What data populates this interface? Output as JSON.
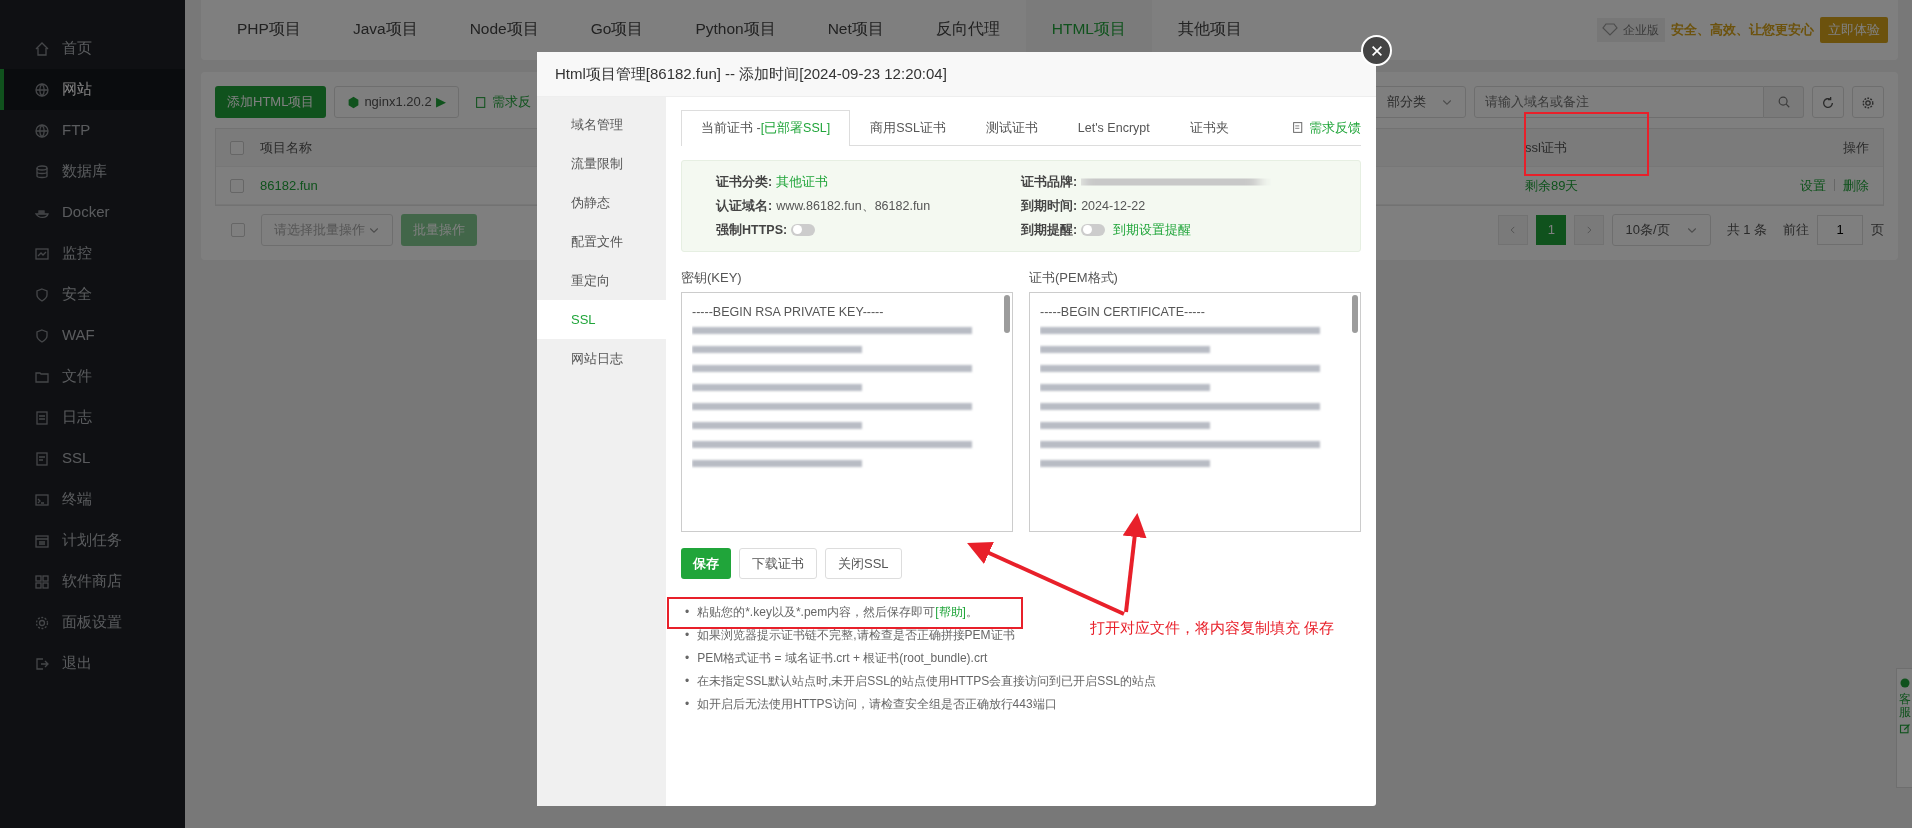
{
  "sidebar": {
    "items": [
      {
        "label": "首页",
        "selected": false
      },
      {
        "label": "网站",
        "selected": true
      },
      {
        "label": "FTP",
        "selected": false
      },
      {
        "label": "数据库",
        "selected": false
      },
      {
        "label": "Docker",
        "selected": false
      },
      {
        "label": "监控",
        "selected": false
      },
      {
        "label": "安全",
        "selected": false
      },
      {
        "label": "WAF",
        "selected": false
      },
      {
        "label": "文件",
        "selected": false
      },
      {
        "label": "日志",
        "selected": false
      },
      {
        "label": "SSL",
        "selected": false
      },
      {
        "label": "终端",
        "selected": false
      },
      {
        "label": "计划任务",
        "selected": false
      },
      {
        "label": "软件商店",
        "selected": false
      },
      {
        "label": "面板设置",
        "selected": false
      },
      {
        "label": "退出",
        "selected": false
      }
    ]
  },
  "top_tabs": [
    {
      "label": "PHP项目",
      "selected": false
    },
    {
      "label": "Java项目",
      "selected": false
    },
    {
      "label": "Node项目",
      "selected": false
    },
    {
      "label": "Go项目",
      "selected": false
    },
    {
      "label": "Python项目",
      "selected": false
    },
    {
      "label": "Net项目",
      "selected": false
    },
    {
      "label": "反向代理",
      "selected": false
    },
    {
      "label": "HTML项目",
      "selected": true
    },
    {
      "label": "其他项目",
      "selected": false
    }
  ],
  "promo": {
    "badge": "企业版",
    "slogan": "安全、高效、让您更安心",
    "button": "立即体验"
  },
  "toolbar": {
    "add_button": "添加HTML项目",
    "nginx_button": "nginx1.20.2",
    "nginx_play": "▶",
    "feedback": "需求反",
    "category_select": "部分类",
    "search_placeholder": "请输入域名或备注"
  },
  "table": {
    "columns": [
      "项目名称",
      "ssl证书",
      "操作"
    ],
    "select_all_checked": false,
    "rows": [
      {
        "checked": false,
        "name": "86182.fun",
        "ssl": "剩余89天",
        "actions": [
          "设置",
          "删除"
        ]
      }
    ]
  },
  "batch": {
    "checked": false,
    "select_placeholder": "请选择批量操作",
    "button": "批量操作"
  },
  "pagination": {
    "pages": [
      {
        "label": "1",
        "selected": true
      }
    ],
    "page_size": "10条/页",
    "total": "共 1 条",
    "goto_label": "前往",
    "goto_value": "1",
    "page_suffix": "页"
  },
  "float_bar": {
    "service": "客服"
  },
  "modal": {
    "title": "Html项目管理[86182.fun] -- 添加时间[2024-09-23 12:20:04]",
    "nav": [
      {
        "label": "域名管理",
        "selected": false
      },
      {
        "label": "流量限制",
        "selected": false
      },
      {
        "label": "伪静态",
        "selected": false
      },
      {
        "label": "配置文件",
        "selected": false
      },
      {
        "label": "重定向",
        "selected": false
      },
      {
        "label": "SSL",
        "selected": true
      },
      {
        "label": "网站日志",
        "selected": false
      }
    ],
    "tabs": [
      {
        "label": "当前证书 -",
        "status": "[已部署SSL]",
        "selected": true
      },
      {
        "label": "商用SSL证书",
        "selected": false
      },
      {
        "label": "测试证书",
        "selected": false
      },
      {
        "label": "Let's Encrypt",
        "selected": false
      },
      {
        "label": "证书夹",
        "selected": false
      }
    ],
    "feedback": "需求反馈",
    "info": [
      {
        "kind": "link",
        "label": "证书分类:",
        "value": "其他证书"
      },
      {
        "kind": "blurred",
        "label": "证书品牌:"
      },
      {
        "kind": "text",
        "label": "认证域名:",
        "value": "www.86182.fun、86182.fun"
      },
      {
        "kind": "text",
        "label": "到期时间:",
        "value": "2024-12-22"
      },
      {
        "kind": "switch",
        "label": "强制HTTPS:",
        "on": false
      },
      {
        "kind": "switch",
        "label": "到期提醒:",
        "on": false,
        "link": "到期设置提醒"
      }
    ],
    "fields": [
      {
        "label": "密钥(KEY)",
        "first_line": "-----BEGIN RSA PRIVATE KEY-----"
      },
      {
        "label": "证书(PEM格式)",
        "first_line": "-----BEGIN CERTIFICATE-----"
      }
    ],
    "buttons": [
      {
        "label": "保存",
        "kind": "primary"
      },
      {
        "label": "下载证书",
        "kind": "default"
      },
      {
        "label": "关闭SSL",
        "kind": "default"
      }
    ],
    "notes": [
      {
        "bullet": "•",
        "text": "粘贴您的*.key以及*.pem内容，然后保存即可",
        "link": "[帮助]",
        "end": "。"
      },
      {
        "bullet": "•",
        "text": "如果浏览器提示证书链不完整,请检查是否正确拼接PEM证书"
      },
      {
        "bullet": "•",
        "text": "PEM格式证书 = 域名证书.crt + 根证书(root_bundle).crt"
      },
      {
        "bullet": "•",
        "text": "在未指定SSL默认站点时,未开启SSL的站点使用HTTPS会直接访问到已开启SSL的站点"
      },
      {
        "bullet": "•",
        "text": "如开启后无法使用HTTPS访问，请检查安全组是否正确放行443端口"
      }
    ]
  },
  "annotation": {
    "text": "打开对应文件，将内容复制填充 保存"
  }
}
